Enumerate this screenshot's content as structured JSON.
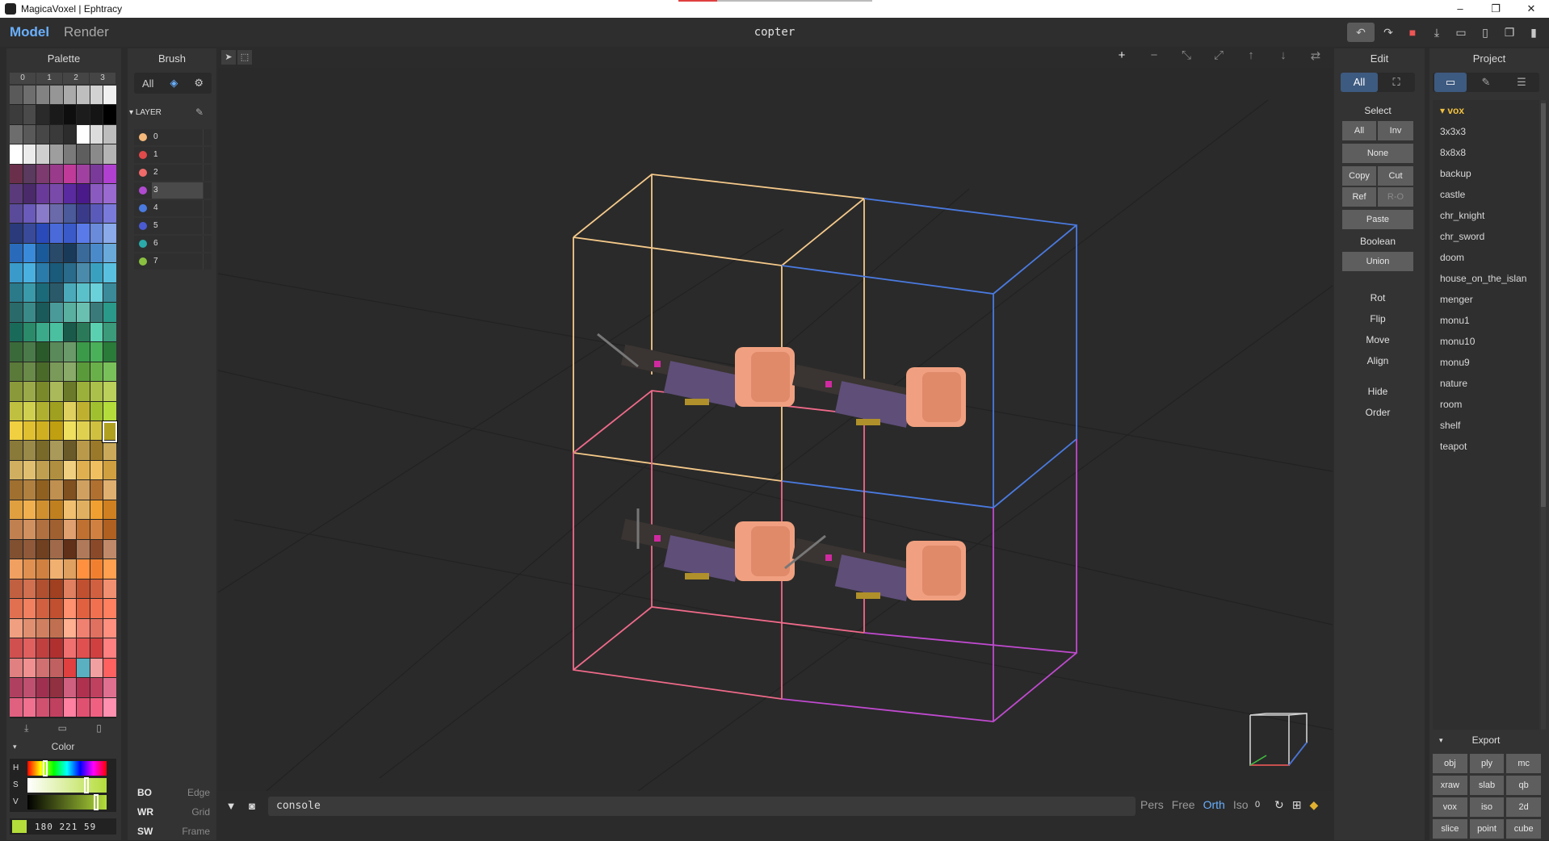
{
  "window": {
    "title": "MagicaVoxel | Ephtracy",
    "controls": [
      "–",
      "❐",
      "✕"
    ]
  },
  "menu": {
    "model_tab": "Model",
    "render_tab": "Render",
    "document_title": "copter"
  },
  "top_actions": [
    "undo-icon",
    "redo-icon",
    "save-icon",
    "export-icon",
    "open-icon",
    "new-icon",
    "copy-icon",
    "delete-icon"
  ],
  "palette": {
    "title": "Palette",
    "tabs": [
      "0",
      "1",
      "2",
      "3"
    ],
    "actions": [
      "import-icon",
      "open-icon",
      "new-icon"
    ],
    "selected_index": 143,
    "colors": [
      "#5a5a5a",
      "#6e6e6e",
      "#828282",
      "#969696",
      "#aaaaaa",
      "#bebebe",
      "#d2d2d2",
      "#f0f0f0",
      "#3c3c3c",
      "#4a4a4a",
      "#2a2a2a",
      "#1a1a1a",
      "#0e0e0e",
      "#1c1c1c",
      "#141414",
      "#000000",
      "#6d6d6d",
      "#595959",
      "#474747",
      "#3a3a3a",
      "#2c2c2c",
      "#ffffff",
      "#dcdcdc",
      "#bdbdbd",
      "#ffffff",
      "#ececec",
      "#cfcfcf",
      "#9e9e9e",
      "#7a7a7a",
      "#5e5e5e",
      "#8a8a8a",
      "#b4b4b4",
      "#6a2f4a",
      "#5a3a5e",
      "#7c3a6e",
      "#9a3a8a",
      "#c03a9a",
      "#a040a0",
      "#7a3a9a",
      "#b040d0",
      "#5a3a7a",
      "#4a2a6a",
      "#6a3a9a",
      "#7a4aaa",
      "#5a2aa0",
      "#4a1a8a",
      "#8a5ac0",
      "#9a6ad0",
      "#5a4a9a",
      "#6a5aba",
      "#8a7aca",
      "#6a6aaa",
      "#4a5a9a",
      "#3a3a8a",
      "#5a5aba",
      "#7a7ada",
      "#2a3a7a",
      "#3a4a9a",
      "#2a4aba",
      "#4a6ada",
      "#3a5aca",
      "#5a7aea",
      "#6a8ada",
      "#8aaaea",
      "#2a6aba",
      "#3a8ada",
      "#1a5a9a",
      "#2a4a6a",
      "#1a3a5a",
      "#3a6a9a",
      "#4a8aca",
      "#6aaada",
      "#3a9aca",
      "#4ab0e0",
      "#2a7aaa",
      "#1a5a7a",
      "#2a6a8a",
      "#4a8aaa",
      "#3aa0c0",
      "#5ac0e0",
      "#2a7a8a",
      "#3a9aaa",
      "#1a6a7a",
      "#2a5a6a",
      "#4aaaba",
      "#5ac0ca",
      "#6ad0da",
      "#3a8a9a",
      "#2a6a6a",
      "#3a8a8a",
      "#1a5a5a",
      "#4a9a9a",
      "#5ab0a0",
      "#6ac0b0",
      "#3a7a7a",
      "#2a9a8a",
      "#1a6a5a",
      "#2a8a6a",
      "#3aaa8a",
      "#4ac0a0",
      "#1a5a4a",
      "#2a7a5a",
      "#5ad0b0",
      "#3a9a7a",
      "#3a6a3a",
      "#4a7a4a",
      "#2a5a2a",
      "#5a8a5a",
      "#6a9a6a",
      "#3a9a4a",
      "#4ab05a",
      "#2a7a3a",
      "#5a7a3a",
      "#6a8a4a",
      "#4a6a2a",
      "#7a9a5a",
      "#8aaa6a",
      "#5a9a3a",
      "#6ab04a",
      "#7ac05a",
      "#8a9a3a",
      "#9aaa4a",
      "#7a8a2a",
      "#aaba5a",
      "#6a7a2a",
      "#9ab03a",
      "#aac04a",
      "#bad05a",
      "#c0c040",
      "#d0d050",
      "#b0b030",
      "#a0a020",
      "#e0d060",
      "#c0b030",
      "#a0c030",
      "#b4dd3b",
      "#f0d040",
      "#e0c030",
      "#d0b020",
      "#c0a010",
      "#f0e060",
      "#e0d050",
      "#d0c040",
      "#b0a020",
      "#8a7a3a",
      "#9a8a4a",
      "#7a6a2a",
      "#aa9a5a",
      "#6a5a2a",
      "#ba9a4a",
      "#9a7a2a",
      "#caaa5a",
      "#d0b060",
      "#e0c070",
      "#c0a050",
      "#b09040",
      "#f0d080",
      "#e0b050",
      "#f0c060",
      "#d0a040",
      "#a07030",
      "#b08040",
      "#906020",
      "#c09050",
      "#805020",
      "#d0a060",
      "#b07030",
      "#e0b070",
      "#e0a040",
      "#f0b050",
      "#d09030",
      "#c08020",
      "#f0c070",
      "#e0b060",
      "#f0a030",
      "#d08020",
      "#c08050",
      "#d09060",
      "#b07040",
      "#a06030",
      "#e0a070",
      "#c07030",
      "#d08040",
      "#b06020",
      "#805030",
      "#905a3a",
      "#704020",
      "#a06a4a",
      "#603018",
      "#b07a5a",
      "#8a4a2a",
      "#c08a6a",
      "#f0a060",
      "#e09050",
      "#d08040",
      "#f0b070",
      "#e0a060",
      "#ff9040",
      "#f08030",
      "#ffa050",
      "#c06040",
      "#d07050",
      "#b05030",
      "#a04020",
      "#e08060",
      "#c05030",
      "#d06040",
      "#f09070",
      "#e07050",
      "#f08060",
      "#d06040",
      "#c05030",
      "#ff9070",
      "#e06040",
      "#f07050",
      "#ff8060",
      "#f0a080",
      "#e09070",
      "#d08060",
      "#c07050",
      "#ffb090",
      "#f08070",
      "#e07060",
      "#ff9080",
      "#d05050",
      "#e06060",
      "#c04040",
      "#b03030",
      "#f07070",
      "#e05050",
      "#d04040",
      "#ff8080",
      "#e08080",
      "#f09090",
      "#d07070",
      "#c06060",
      "#e04040",
      "#5ab0c0",
      "#f0a0a0",
      "#ff6060",
      "#b04060",
      "#c05070",
      "#a03050",
      "#903040",
      "#d06080",
      "#b03050",
      "#c04060",
      "#e07090",
      "#e06080",
      "#f07090",
      "#d05070",
      "#c04060",
      "#ff80a0",
      "#e05070",
      "#f06080",
      "#ff90b0",
      "#f0a0b0",
      "#e090a0",
      "#d08090",
      "#c07080",
      "#ffb0c0",
      "#f090a0",
      "#e08090",
      "#ffc0d0",
      "#ffffff",
      "#f0c0d0",
      "#e0b0c0",
      "#d0a0b0",
      "#ffd0e0",
      "#f0b0c0",
      "#e0a0b0",
      "#ffe0f0"
    ]
  },
  "color": {
    "title": "Color",
    "h_label": "H",
    "s_label": "S",
    "v_label": "V",
    "h": 0.22,
    "s": 0.74,
    "v": 0.87,
    "swatch": "#b4dd3b",
    "rgb_text": "180 221 59"
  },
  "brush": {
    "title": "Brush",
    "tools": [
      "All",
      "layers-icon",
      "gear-icon"
    ],
    "layer_header": "LAYER",
    "active_layer": "3",
    "layers": [
      {
        "name": "0",
        "color": "#f5b87a"
      },
      {
        "name": "1",
        "color": "#e04a4a"
      },
      {
        "name": "2",
        "color": "#f06a6a"
      },
      {
        "name": "3",
        "color": "#b04ad0"
      },
      {
        "name": "4",
        "color": "#4a7ae0"
      },
      {
        "name": "5",
        "color": "#4a5ad0"
      },
      {
        "name": "6",
        "color": "#2aaaaa"
      },
      {
        "name": "7",
        "color": "#8ac040"
      }
    ],
    "options": [
      {
        "key": "BO",
        "value": "Edge"
      },
      {
        "key": "WR",
        "value": "Grid"
      },
      {
        "key": "SW",
        "value": "Frame"
      }
    ]
  },
  "viewport_tools": {
    "left": [
      "cursor-icon",
      "box-select-icon"
    ],
    "right": [
      "+",
      "−",
      "⤡",
      "⤢",
      "↑",
      "↓",
      "⇄"
    ]
  },
  "console": {
    "placeholder": "console",
    "views": [
      "Pers",
      "Free",
      "Orth",
      "Iso"
    ],
    "active_view": "Orth",
    "frame": "0"
  },
  "edit": {
    "title": "Edit",
    "mode_all": "All",
    "mode_fit": "⛶",
    "select_label": "Select",
    "btn_all": "All",
    "btn_inv": "Inv",
    "btn_none": "None",
    "btn_copy": "Copy",
    "btn_cut": "Cut",
    "btn_ref": "Ref",
    "btn_ro": "R-O",
    "btn_paste": "Paste",
    "boolean_label": "Boolean",
    "btn_union": "Union",
    "rot": "Rot",
    "flip": "Flip",
    "move": "Move",
    "align": "Align",
    "hide": "Hide",
    "order": "Order"
  },
  "project": {
    "title": "Project",
    "tools": [
      "folder-icon",
      "brush-icon",
      "list-icon"
    ],
    "folder": "vox",
    "items": [
      "3x3x3",
      "8x8x8",
      "backup",
      "castle",
      "chr_knight",
      "chr_sword",
      "doom",
      "house_on_the_islan",
      "menger",
      "monu1",
      "monu10",
      "monu9",
      "nature",
      "room",
      "shelf",
      "teapot"
    ]
  },
  "export": {
    "title": "Export",
    "formats": [
      "obj",
      "ply",
      "mc",
      "xraw",
      "slab",
      "qb",
      "vox",
      "iso",
      "2d",
      "slice",
      "point",
      "cube"
    ]
  },
  "colors": {
    "accent": "#6ab0ff",
    "bg": "#2b2b2b",
    "panel": "#333333",
    "box_peach": "#f5c98a",
    "box_blue": "#4a7ae0",
    "box_pink": "#f06a8a",
    "box_magenta": "#c04ad0"
  }
}
